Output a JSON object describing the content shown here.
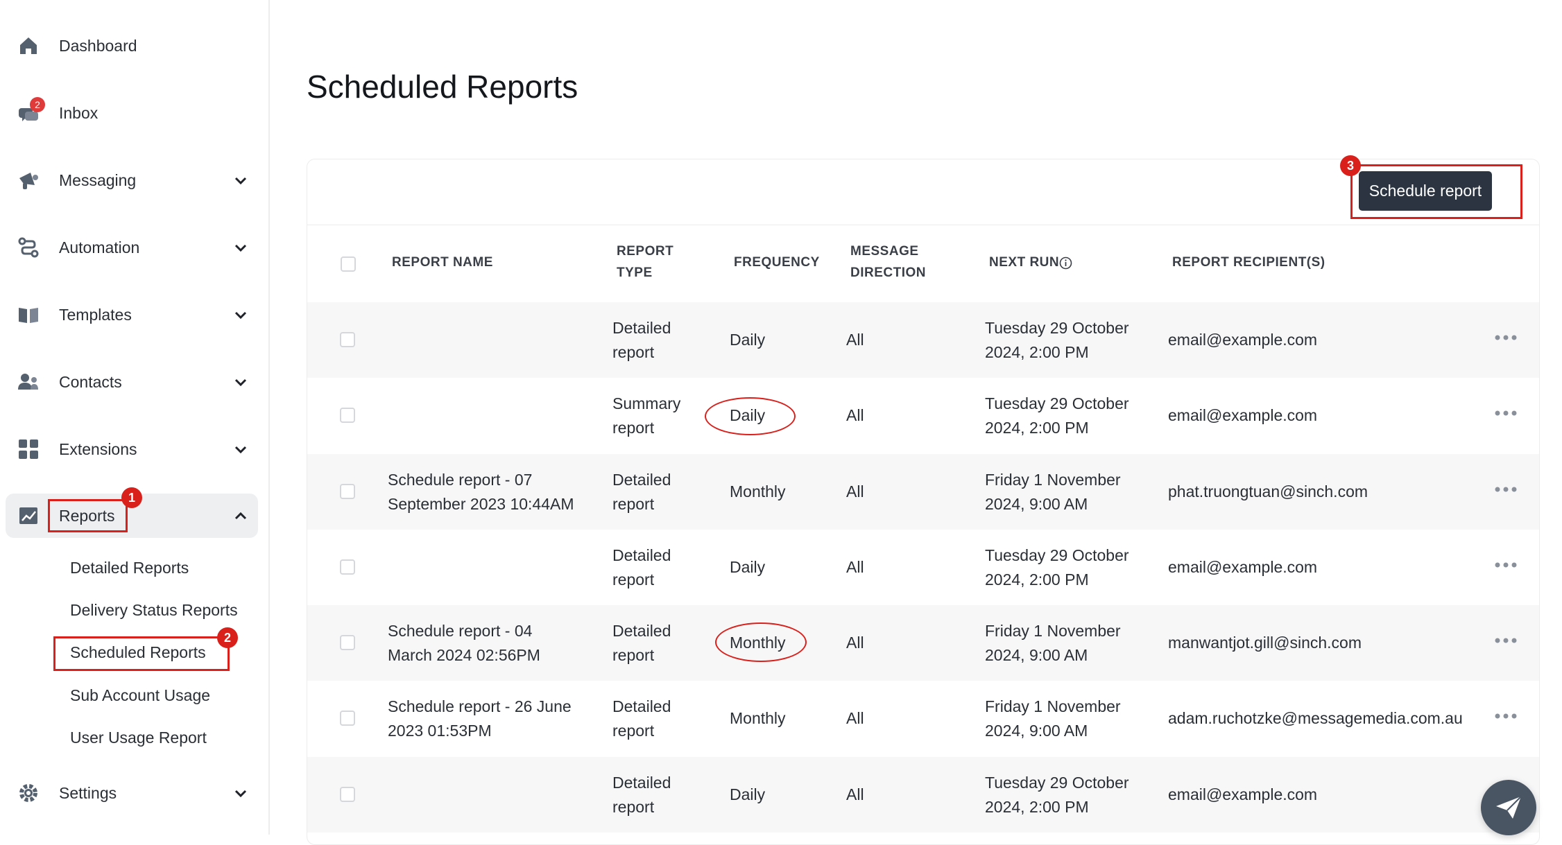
{
  "sidebar": {
    "items": [
      {
        "label": "Dashboard",
        "icon": "home-icon"
      },
      {
        "label": "Inbox",
        "icon": "chat-icon",
        "badge": "2"
      },
      {
        "label": "Messaging",
        "icon": "megaphone-icon"
      },
      {
        "label": "Automation",
        "icon": "flow-icon"
      },
      {
        "label": "Templates",
        "icon": "book-icon"
      },
      {
        "label": "Contacts",
        "icon": "users-icon"
      },
      {
        "label": "Extensions",
        "icon": "grid-icon"
      },
      {
        "label": "Reports",
        "icon": "chart-icon"
      },
      {
        "label": "Settings",
        "icon": "gear-icon"
      }
    ],
    "reports_sub": [
      {
        "label": "Detailed Reports"
      },
      {
        "label": "Delivery Status Reports"
      },
      {
        "label": "Scheduled Reports"
      },
      {
        "label": "Sub Account Usage"
      },
      {
        "label": "User Usage Report"
      }
    ]
  },
  "annotations": {
    "step1": "1",
    "step2": "2",
    "step3": "3"
  },
  "main": {
    "title": "Scheduled Reports",
    "schedule_button": "Schedule report",
    "columns": {
      "name": "REPORT NAME",
      "type_line1": "REPORT",
      "type_line2": "TYPE",
      "frequency": "FREQUENCY",
      "direction_line1": "MESSAGE",
      "direction_line2": "DIRECTION",
      "next_run": "NEXT RUN",
      "recipients": "REPORT RECIPIENT(S)"
    },
    "rows": [
      {
        "name1": "",
        "name2": "",
        "type1": "Detailed",
        "type2": "report",
        "frequency": "Daily",
        "direction": "All",
        "next1": "Tuesday 29 October",
        "next2": "2024, 2:00 PM",
        "recipient": "email@example.com"
      },
      {
        "name1": "",
        "name2": "",
        "type1": "Summary",
        "type2": "report",
        "frequency": "Daily",
        "direction": "All",
        "next1": "Tuesday 29 October",
        "next2": "2024, 2:00 PM",
        "recipient": "email@example.com"
      },
      {
        "name1": "Schedule report - 07",
        "name2": "September 2023 10:44AM",
        "type1": "Detailed",
        "type2": "report",
        "frequency": "Monthly",
        "direction": "All",
        "next1": "Friday 1 November",
        "next2": "2024, 9:00 AM",
        "recipient": "phat.truongtuan@sinch.com"
      },
      {
        "name1": "",
        "name2": "",
        "type1": "Detailed",
        "type2": "report",
        "frequency": "Daily",
        "direction": "All",
        "next1": "Tuesday 29 October",
        "next2": "2024, 2:00 PM",
        "recipient": "email@example.com"
      },
      {
        "name1": "Schedule report - 04",
        "name2": "March 2024 02:56PM",
        "type1": "Detailed",
        "type2": "report",
        "frequency": "Monthly",
        "direction": "All",
        "next1": "Friday 1 November",
        "next2": "2024, 9:00 AM",
        "recipient": "manwantjot.gill@sinch.com"
      },
      {
        "name1": "Schedule report - 26 June",
        "name2": "2023 01:53PM",
        "type1": "Detailed",
        "type2": "report",
        "frequency": "Monthly",
        "direction": "All",
        "next1": "Friday 1 November",
        "next2": "2024, 9:00 AM",
        "recipient": "adam.ruchotzke@messagemedia.com.au"
      },
      {
        "name1": "",
        "name2": "",
        "type1": "Detailed",
        "type2": "report",
        "frequency": "Daily",
        "direction": "All",
        "next1": "Tuesday 29 October",
        "next2": "2024, 2:00 PM",
        "recipient": "email@example.com"
      }
    ]
  }
}
